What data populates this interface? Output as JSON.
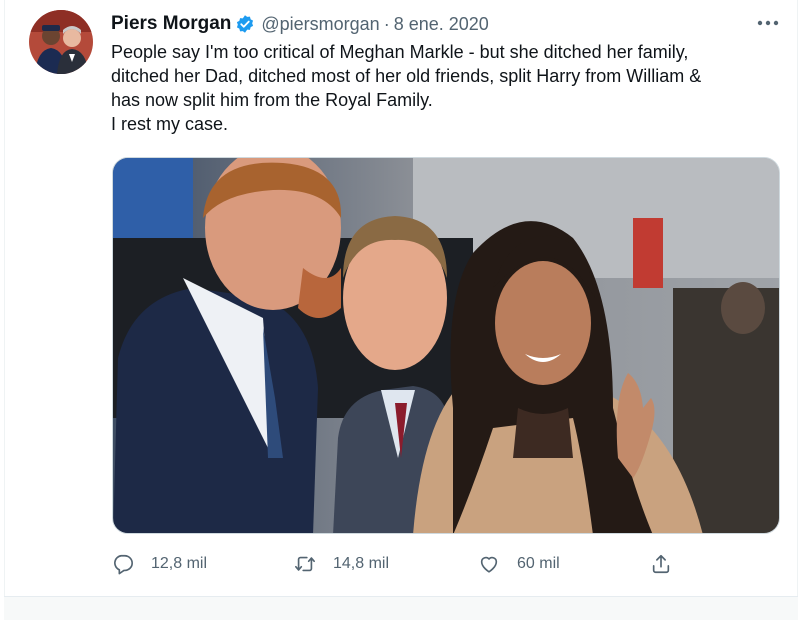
{
  "tweet": {
    "display_name": "Piers Morgan",
    "handle": "@piersmorgan",
    "separator": "·",
    "timestamp": "8 ene. 2020",
    "text_lines": [
      "People say I'm too critical of Meghan Markle - but she ditched her family,",
      "ditched her Dad, ditched most of her old friends, split Harry from William &",
      "has now split him from the Royal Family.",
      "I rest my case."
    ],
    "verified": true
  },
  "actions": {
    "reply": {
      "icon": "reply-icon",
      "count": "12,8 mil"
    },
    "retweet": {
      "icon": "retweet-icon",
      "count": "14,8 mil"
    },
    "like": {
      "icon": "heart-icon",
      "count": "60 mil"
    },
    "share": {
      "icon": "share-icon"
    }
  },
  "colors": {
    "text": "#0f1419",
    "secondary": "#536471",
    "verified_blue": "#1d9bf0",
    "border": "#cfd9de"
  }
}
